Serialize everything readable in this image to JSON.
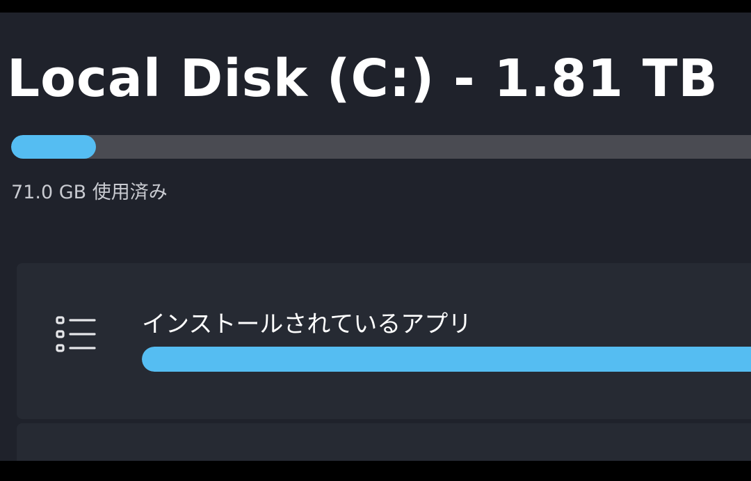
{
  "disk": {
    "title": "Local Disk (C:) - 1.81 TB",
    "used_text": "71.0 GB 使用済み",
    "used_fraction": 0.115
  },
  "category": {
    "label": "インストールされているアプリ",
    "icon": "list-icon",
    "fill_fraction": 1.0
  },
  "colors": {
    "accent": "#55bdf2",
    "track": "#4a4b52",
    "background": "#1f222b",
    "card": "#262a33"
  }
}
